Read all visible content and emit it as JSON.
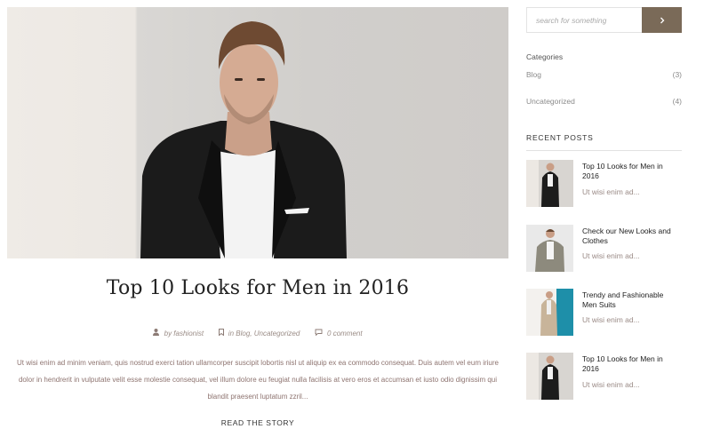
{
  "post": {
    "title": "Top 10 Looks for Men in 2016",
    "author": "by fashionist",
    "categories_prefix": "in",
    "categories": "Blog, Uncategorized",
    "comments": "0 comment",
    "excerpt": "Ut wisi enim ad minim veniam, quis nostrud exerci tation ullamcorper suscipit lobortis nisl ut aliquip ex ea commodo consequat. Duis autem vel eum iriure dolor in hendrerit in vulputate velit esse molestie consequat, vel illum dolore eu feugiat nulla facilisis at vero eros et accumsan et iusto odio dignissim qui blandit praesent luptatum zzril...",
    "read_more": "READ THE STORY"
  },
  "sidebar": {
    "search": {
      "placeholder": "search for something"
    },
    "categories_title": "Categories",
    "categories": [
      {
        "name": "Blog",
        "count": "(3)"
      },
      {
        "name": "Uncategorized",
        "count": "(4)"
      }
    ],
    "recent_title": "RECENT POSTS",
    "recent_posts": [
      {
        "title": "Top 10 Looks for Men in 2016",
        "excerpt": "Ut wisi enim ad..."
      },
      {
        "title": "Check our New Looks and Clothes",
        "excerpt": "Ut wisi enim ad..."
      },
      {
        "title": "Trendy and Fashionable Men Suits",
        "excerpt": "Ut wisi enim ad..."
      },
      {
        "title": "Top 10 Looks for Men in 2016",
        "excerpt": "Ut wisi enim ad..."
      }
    ]
  },
  "icons": {
    "author": "user-icon",
    "category": "bookmark-icon",
    "comment": "comment-icon",
    "search_button": "chevron-right-icon"
  },
  "colors": {
    "accent": "#7a6a58",
    "meta_text": "#9a8c86",
    "excerpt_text": "#8e7470"
  }
}
